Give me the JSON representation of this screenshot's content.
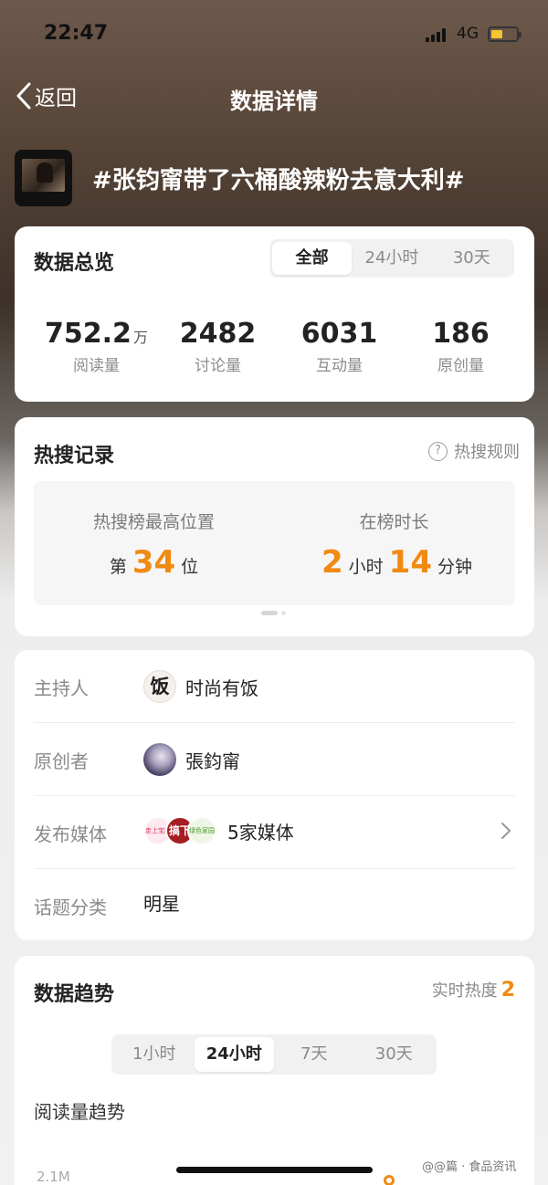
{
  "status_bar": {
    "time": "22:47",
    "network": "4G"
  },
  "nav": {
    "back_label": "返回",
    "title": "数据详情"
  },
  "topic": {
    "title": "#张钧甯带了六桶酸辣粉去意大利#"
  },
  "overview": {
    "title": "数据总览",
    "tabs": [
      {
        "label": "全部",
        "active": true
      },
      {
        "label": "24小时",
        "active": false
      },
      {
        "label": "30天",
        "active": false
      }
    ],
    "stats": [
      {
        "value": "752.2",
        "unit": "万",
        "label": "阅读量"
      },
      {
        "value": "2482",
        "unit": "",
        "label": "讨论量"
      },
      {
        "value": "6031",
        "unit": "",
        "label": "互动量"
      },
      {
        "value": "186",
        "unit": "",
        "label": "原创量"
      }
    ]
  },
  "hot_search": {
    "title": "热搜记录",
    "rule_label": "热搜规则",
    "highest": {
      "label": "热搜榜最高位置",
      "prefix": "第",
      "value": "34",
      "suffix": "位"
    },
    "duration": {
      "label": "在榜时长",
      "hours": "2",
      "hour_unit": "小时",
      "minutes": "14",
      "minute_unit": "分钟"
    }
  },
  "info": {
    "host": {
      "label": "主持人",
      "avatar_text": "饭",
      "name": "时尚有饭"
    },
    "creator": {
      "label": "原创者",
      "name": "張鈞甯"
    },
    "media": {
      "label": "发布媒体",
      "avatar_texts": [
        "走上宝藤",
        "搞下",
        "绿色家园"
      ],
      "value": "5家媒体"
    },
    "category": {
      "label": "话题分类",
      "value": "明星"
    }
  },
  "trend": {
    "title": "数据趋势",
    "realtime_label": "实时热度",
    "realtime_value": "2",
    "tabs": [
      {
        "label": "1小时",
        "active": false
      },
      {
        "label": "24小时",
        "active": true
      },
      {
        "label": "7天",
        "active": false
      },
      {
        "label": "30天",
        "active": false
      }
    ],
    "chart_title": "阅读量趋势",
    "y_tick": "2.1M"
  },
  "watermark": "@@篇 · 食品资讯",
  "colors": {
    "accent": "#f08a12",
    "card_bg": "#ffffff",
    "muted_text": "#8a8a8a"
  }
}
